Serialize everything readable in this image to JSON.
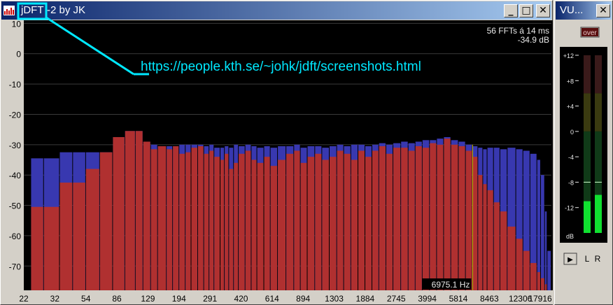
{
  "main_window": {
    "title_prefix": "jDFT",
    "title_rest": "-2 by JK",
    "minimize_glyph": "_",
    "maximize_glyph": "□",
    "close_glyph": "✕"
  },
  "vu_window": {
    "title": "VU...",
    "close_glyph": "✕",
    "over_label": "over",
    "scale_labels": [
      "+12",
      "+8",
      "+4",
      "0",
      "-4",
      "-8",
      "-12",
      "dB"
    ],
    "channel_labels": [
      "L",
      "R"
    ],
    "play_glyph": "▶",
    "levels_db": {
      "L": -11,
      "R": -10
    },
    "peaks_db": {
      "L": -8,
      "R": -8
    }
  },
  "annotation": {
    "url": "https://people.kth.se/~johk/jdft/screenshots.html",
    "color": "#00e8ff"
  },
  "spectrum": {
    "info_line1": "56 FFTs á 14 ms",
    "info_line2": "-34.9 dB",
    "cursor_label": "6975.1 Hz",
    "y_ticks": [
      10,
      0,
      -10,
      -20,
      -30,
      -40,
      -50,
      -60,
      -70
    ],
    "y_min": -78,
    "y_max": 11,
    "x_ticks": [
      "22",
      "32",
      "54",
      "86",
      "129",
      "194",
      "291",
      "420",
      "614",
      "894",
      "1303",
      "1884",
      "2745",
      "3994",
      "5814",
      "8463",
      "12306",
      "17916"
    ],
    "colors": {
      "current": "#b03030",
      "peak": "#3838b0",
      "cursor": "#c8c000",
      "grid": "#3a3a3a"
    },
    "bars": [
      {
        "f": 22,
        "cur": -50.5,
        "pk": -34.5
      },
      {
        "f": 26,
        "cur": -50.5,
        "pk": -34.5
      },
      {
        "f": 32,
        "cur": -42.5,
        "pk": -32.5
      },
      {
        "f": 38,
        "cur": -42.5,
        "pk": -32.5
      },
      {
        "f": 45,
        "cur": -38,
        "pk": -32.5
      },
      {
        "f": 54,
        "cur": -32.5,
        "pk": -32.5
      },
      {
        "f": 64,
        "cur": -27.5,
        "pk": -27.5
      },
      {
        "f": 75,
        "cur": -25.5,
        "pk": -25.5
      },
      {
        "f": 86,
        "cur": -25.5,
        "pk": -25.5
      },
      {
        "f": 95,
        "cur": -29,
        "pk": -29
      },
      {
        "f": 105,
        "cur": -31.5,
        "pk": -30
      },
      {
        "f": 115,
        "cur": -30.5,
        "pk": -30.5
      },
      {
        "f": 129,
        "cur": -31.5,
        "pk": -30.5
      },
      {
        "f": 140,
        "cur": -30.5,
        "pk": -30.5
      },
      {
        "f": 152,
        "cur": -33,
        "pk": -30
      },
      {
        "f": 165,
        "cur": -32.5,
        "pk": -30
      },
      {
        "f": 178,
        "cur": -31,
        "pk": -30
      },
      {
        "f": 194,
        "cur": -30.5,
        "pk": -30
      },
      {
        "f": 210,
        "cur": -33,
        "pk": -30.5
      },
      {
        "f": 225,
        "cur": -32,
        "pk": -30
      },
      {
        "f": 240,
        "cur": -34,
        "pk": -31
      },
      {
        "f": 260,
        "cur": -35,
        "pk": -31
      },
      {
        "f": 275,
        "cur": -33,
        "pk": -30.5
      },
      {
        "f": 291,
        "cur": -38,
        "pk": -31
      },
      {
        "f": 310,
        "cur": -36,
        "pk": -30
      },
      {
        "f": 330,
        "cur": -33,
        "pk": -30.5
      },
      {
        "f": 360,
        "cur": -32,
        "pk": -30
      },
      {
        "f": 390,
        "cur": -35,
        "pk": -30.5
      },
      {
        "f": 420,
        "cur": -36,
        "pk": -31
      },
      {
        "f": 460,
        "cur": -34,
        "pk": -30.5
      },
      {
        "f": 500,
        "cur": -37,
        "pk": -31
      },
      {
        "f": 550,
        "cur": -35,
        "pk": -30.5
      },
      {
        "f": 614,
        "cur": -33,
        "pk": -30.5
      },
      {
        "f": 680,
        "cur": -32,
        "pk": -30
      },
      {
        "f": 740,
        "cur": -36,
        "pk": -31
      },
      {
        "f": 810,
        "cur": -34,
        "pk": -30.5
      },
      {
        "f": 894,
        "cur": -33,
        "pk": -30.5
      },
      {
        "f": 980,
        "cur": -35,
        "pk": -31
      },
      {
        "f": 1080,
        "cur": -34,
        "pk": -30.5
      },
      {
        "f": 1190,
        "cur": -32,
        "pk": -30
      },
      {
        "f": 1303,
        "cur": -33,
        "pk": -30.5
      },
      {
        "f": 1430,
        "cur": -35,
        "pk": -30
      },
      {
        "f": 1570,
        "cur": -32,
        "pk": -30
      },
      {
        "f": 1720,
        "cur": -34,
        "pk": -30.5
      },
      {
        "f": 1884,
        "cur": -32,
        "pk": -30
      },
      {
        "f": 2060,
        "cur": -30.5,
        "pk": -29.5
      },
      {
        "f": 2260,
        "cur": -33,
        "pk": -30
      },
      {
        "f": 2480,
        "cur": -31,
        "pk": -29.5
      },
      {
        "f": 2745,
        "cur": -31,
        "pk": -29
      },
      {
        "f": 3020,
        "cur": -32,
        "pk": -29.5
      },
      {
        "f": 3310,
        "cur": -30.5,
        "pk": -29
      },
      {
        "f": 3630,
        "cur": -31,
        "pk": -28.5
      },
      {
        "f": 3994,
        "cur": -29.5,
        "pk": -28.5
      },
      {
        "f": 4380,
        "cur": -30,
        "pk": -28
      },
      {
        "f": 4800,
        "cur": -28,
        "pk": -27.5
      },
      {
        "f": 5270,
        "cur": -30,
        "pk": -28.5
      },
      {
        "f": 5814,
        "cur": -30.5,
        "pk": -29
      },
      {
        "f": 6380,
        "cur": -32,
        "pk": -30
      },
      {
        "f": 6975,
        "cur": -34,
        "pk": -30.5
      },
      {
        "f": 7500,
        "cur": -40,
        "pk": -31
      },
      {
        "f": 8000,
        "cur": -43,
        "pk": -31.5
      },
      {
        "f": 8463,
        "cur": -45,
        "pk": -31
      },
      {
        "f": 9200,
        "cur": -49,
        "pk": -31
      },
      {
        "f": 10000,
        "cur": -52,
        "pk": -31.5
      },
      {
        "f": 11000,
        "cur": -57,
        "pk": -31
      },
      {
        "f": 12306,
        "cur": -61,
        "pk": -31.5
      },
      {
        "f": 13500,
        "cur": -65,
        "pk": -32
      },
      {
        "f": 14800,
        "cur": -69,
        "pk": -33
      },
      {
        "f": 16200,
        "cur": -72,
        "pk": -35
      },
      {
        "f": 17000,
        "cur": -74,
        "pk": -40
      },
      {
        "f": 17916,
        "cur": -76,
        "pk": -52
      },
      {
        "f": 18500,
        "cur": -78,
        "pk": -65
      }
    ]
  }
}
